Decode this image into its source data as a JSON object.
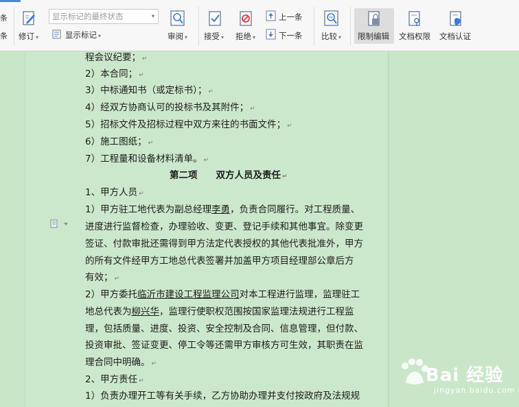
{
  "ribbon": {
    "edge_chars": [
      "条",
      "条"
    ],
    "revise_label": "修订",
    "markup_combo_value": "显示标记的最终状态",
    "show_markup_label": "显示标记",
    "review_label": "审阅",
    "accept_label": "接受",
    "reject_label": "拒绝",
    "prev_label": "上一条",
    "next_label": "下一条",
    "compare_label": "比较",
    "restrict_label": "限制编辑",
    "permission_label": "文档权限",
    "certify_label": "文档认证"
  },
  "document": {
    "lines": [
      "程会议纪要；",
      "2）本合同；",
      "3）中标通知书（或定标书）；",
      "4）经双方协商认可的投标书及其附件；",
      "5）招标文件及招标过程中双方来往的书面文件；",
      "6）施工图纸；",
      "7）工程量和设备材料清单。",
      "第二项　　双方人员及责任",
      "1、甲方人员",
      "1）甲方驻工地代表为副总经理",
      "李勇",
      "，负责合同履行。对工程质量、",
      "进度进行监督检查，办理验收、变更、登记手续和其他事宜。除变更",
      "签证、付款审批还需得到甲方法定代表授权的其他代表批准外，甲方",
      "的所有文件经甲方工地总代表签署并加盖甲方项目经理部公章后方",
      "有效；",
      "2）甲方委托",
      "临沂市建设工程监理公司",
      "对本工程进行监理，监理驻工",
      "地总代表为",
      "柳兴华",
      "，监理行使职权范围按国家监理法规进行工程监",
      "理，包括质量、进度、投资、安全控制及合同、信息管理，但付款、",
      "投资审批、签证变更、停工令等还需甲方审核方可生效，其职责在监",
      "理合同中明确。",
      "2、甲方责任",
      "1）负责办理开工等有关手续，乙方协助办理并支付按政府及法规规"
    ],
    "para_mark": "↵"
  },
  "watermark": {
    "brand": "Bai 经验",
    "url": "jingyan.baidu.com"
  }
}
